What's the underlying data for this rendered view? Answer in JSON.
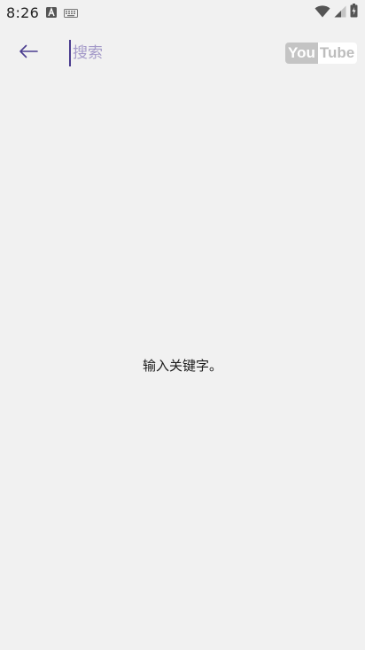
{
  "status_bar": {
    "time": "8:26",
    "icons": [
      "a-letter-icon",
      "keyboard-icon",
      "wifi-icon",
      "signal-icon",
      "battery-icon"
    ]
  },
  "search": {
    "placeholder": "搜索",
    "value": ""
  },
  "logo": {
    "you": "You",
    "tube": "Tube"
  },
  "content": {
    "empty_hint": "输入关键字。"
  },
  "colors": {
    "background": "#f1f1f1",
    "accent": "#4b3d8f",
    "placeholder": "#a49ac9"
  }
}
